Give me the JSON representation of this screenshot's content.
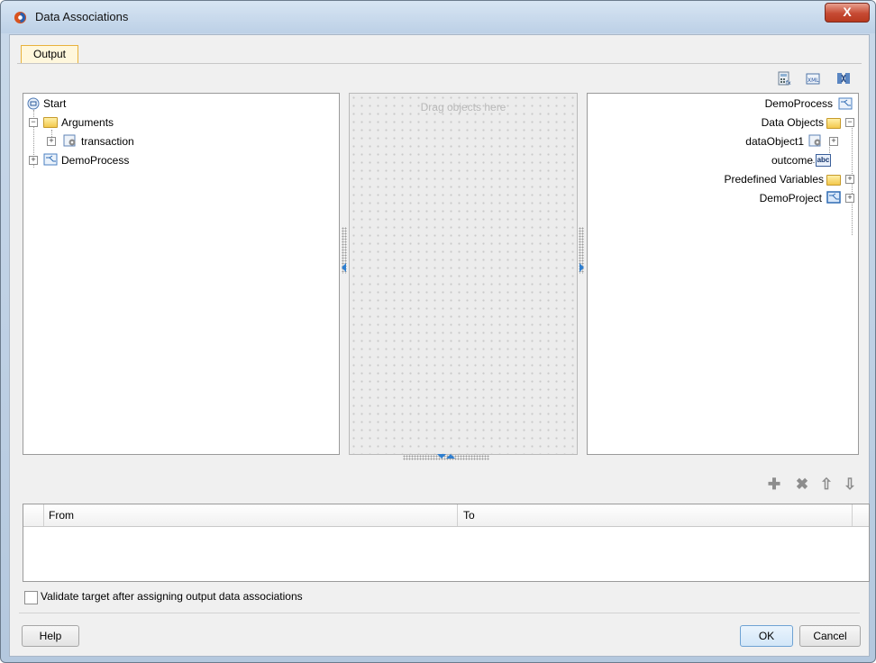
{
  "window": {
    "title": "Data Associations",
    "close_label": "X"
  },
  "tabs": [
    {
      "label": "Output"
    }
  ],
  "toolbar": {
    "icons": [
      "calculator-icon",
      "xml-icon",
      "mapping-icon"
    ]
  },
  "left_tree": [
    {
      "label": "Start",
      "icon": "start-event-icon"
    },
    {
      "label": "Arguments",
      "icon": "folder-icon"
    },
    {
      "label": "transaction",
      "icon": "data-object-icon"
    },
    {
      "label": "DemoProcess",
      "icon": "process-icon"
    }
  ],
  "middle": {
    "placeholder": "Drag objects here"
  },
  "right_tree": [
    {
      "label": "DemoProcess",
      "icon": "process-icon"
    },
    {
      "label": "Data Objects",
      "icon": "folder-icon"
    },
    {
      "label": "dataObject1",
      "icon": "data-object-icon"
    },
    {
      "label": "outcome",
      "icon": "string-icon"
    },
    {
      "label": "Predefined Variables",
      "icon": "folder-icon"
    },
    {
      "label": "DemoProject",
      "icon": "project-icon"
    }
  ],
  "string_badge": "abc",
  "table": {
    "columns": [
      "From",
      "To"
    ],
    "rows": []
  },
  "validate": {
    "label": "Validate target after assigning output data associations",
    "checked": false
  },
  "buttons": {
    "help": "Help",
    "ok": "OK",
    "cancel": "Cancel"
  },
  "colors": {
    "tab_border": "#e9b23c",
    "tab_bg": "#fff7dc",
    "accent_blue": "#2f7fd0"
  }
}
